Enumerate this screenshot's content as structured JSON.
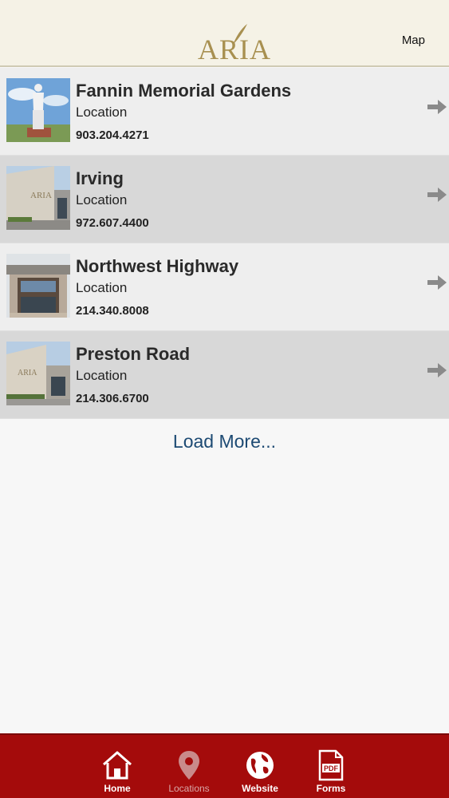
{
  "header": {
    "logo_text": "ARIA",
    "map_label": "Map"
  },
  "locations": [
    {
      "title": "Fannin Memorial Gardens",
      "subtitle": "Location",
      "phone": "903.204.4271"
    },
    {
      "title": "Irving",
      "subtitle": "Location",
      "phone": "972.607.4400"
    },
    {
      "title": "Northwest Highway",
      "subtitle": "Location",
      "phone": "214.340.8008"
    },
    {
      "title": "Preston Road",
      "subtitle": "Location",
      "phone": "214.306.6700"
    }
  ],
  "load_more": "Load More...",
  "tabs": [
    {
      "label": "Home",
      "icon": "home-icon"
    },
    {
      "label": "Locations",
      "icon": "location-pin-icon",
      "active": true
    },
    {
      "label": "Website",
      "icon": "globe-icon"
    },
    {
      "label": "Forms",
      "icon": "pdf-icon"
    }
  ],
  "colors": {
    "header_bg": "#f5f2e6",
    "logo_gold": "#a89050",
    "tabbar_red": "#a40b0b",
    "link_blue": "#1d4a73"
  }
}
